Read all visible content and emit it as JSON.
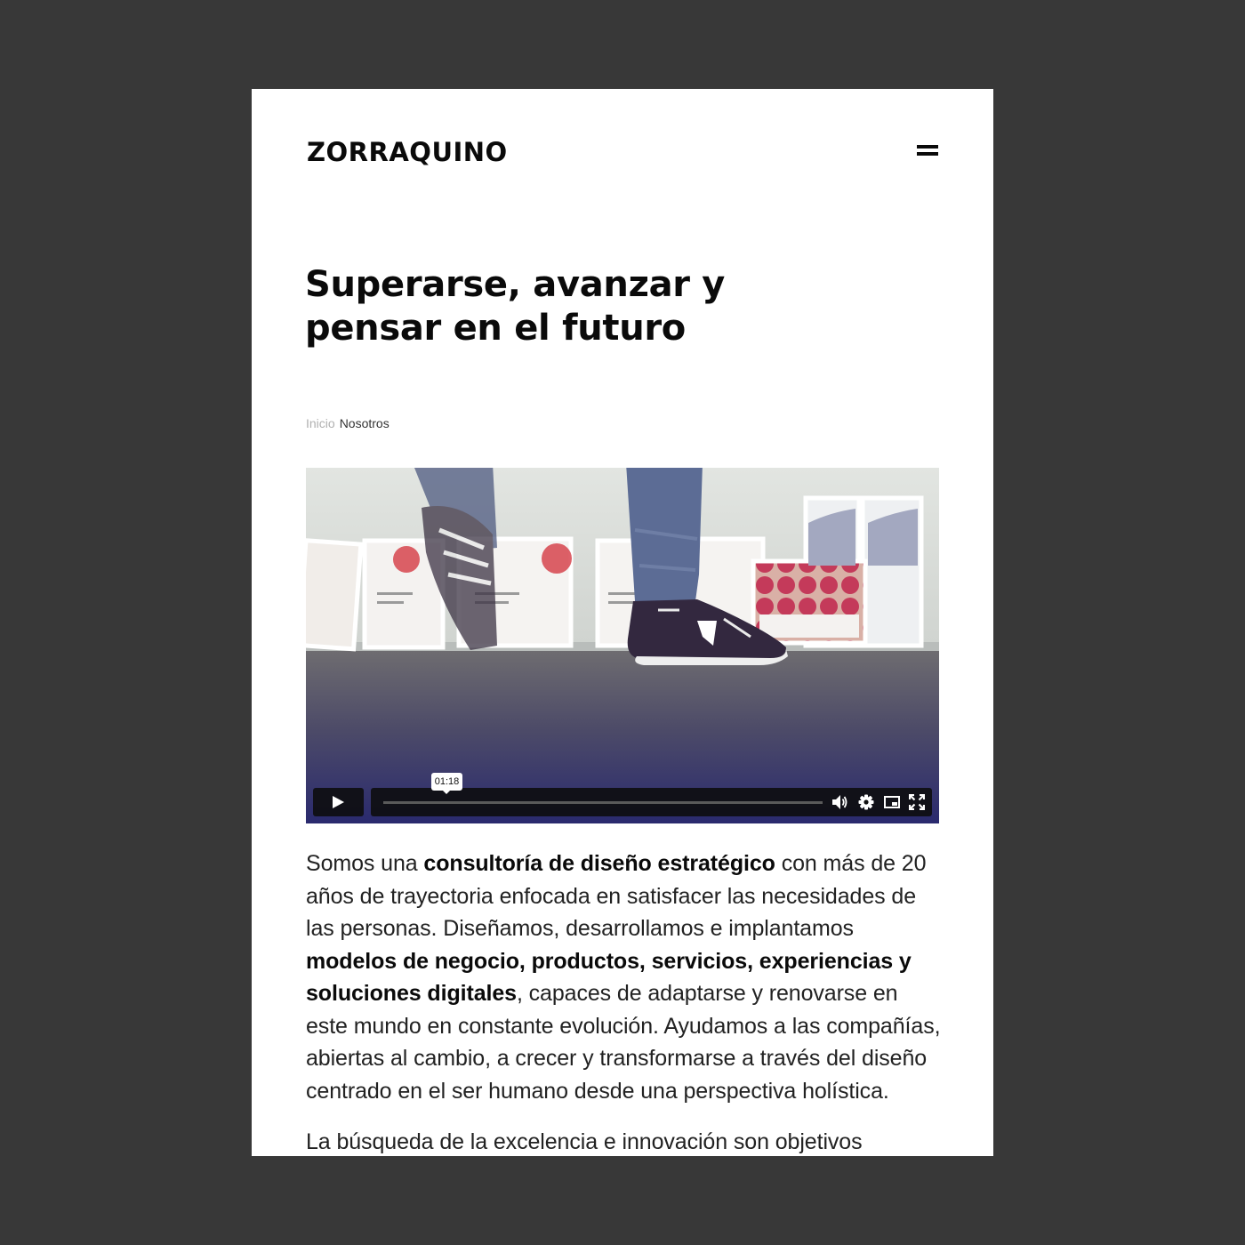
{
  "header": {
    "logo": "ZORRAQUINO",
    "menu_icon": "hamburger-menu-icon"
  },
  "hero": {
    "headline_line1": "Superarse, avanzar y",
    "headline_line2": "pensar en el futuro"
  },
  "breadcrumb": {
    "home": "Inicio",
    "current": "Nosotros"
  },
  "video": {
    "time_tooltip": "01:18",
    "progress": 0,
    "controls": [
      "play-icon",
      "volume-icon",
      "settings-gear-icon",
      "picture-in-picture-icon",
      "fullscreen-icon"
    ]
  },
  "intro": {
    "p1_a": "Somos una ",
    "p1_b": "consultoría de diseño estratégico",
    "p1_c": " con más de 20 años de trayectoria enfocada en satisfacer las necesidades de las personas. Diseñamos, desarrollamos e implantamos ",
    "p1_d": "modelos de negocio, productos, servicios, experiencias y soluciones digitales",
    "p1_e": ", capaces de adaptarse y renovarse en este mundo en constante evolución. Ayudamos a las compañías, abiertas al cambio, a crecer y transformarse a través del diseño centrado en el ser humano desde una perspectiva holística.",
    "p2": "La búsqueda de la excelencia e innovación son objetivos"
  }
}
